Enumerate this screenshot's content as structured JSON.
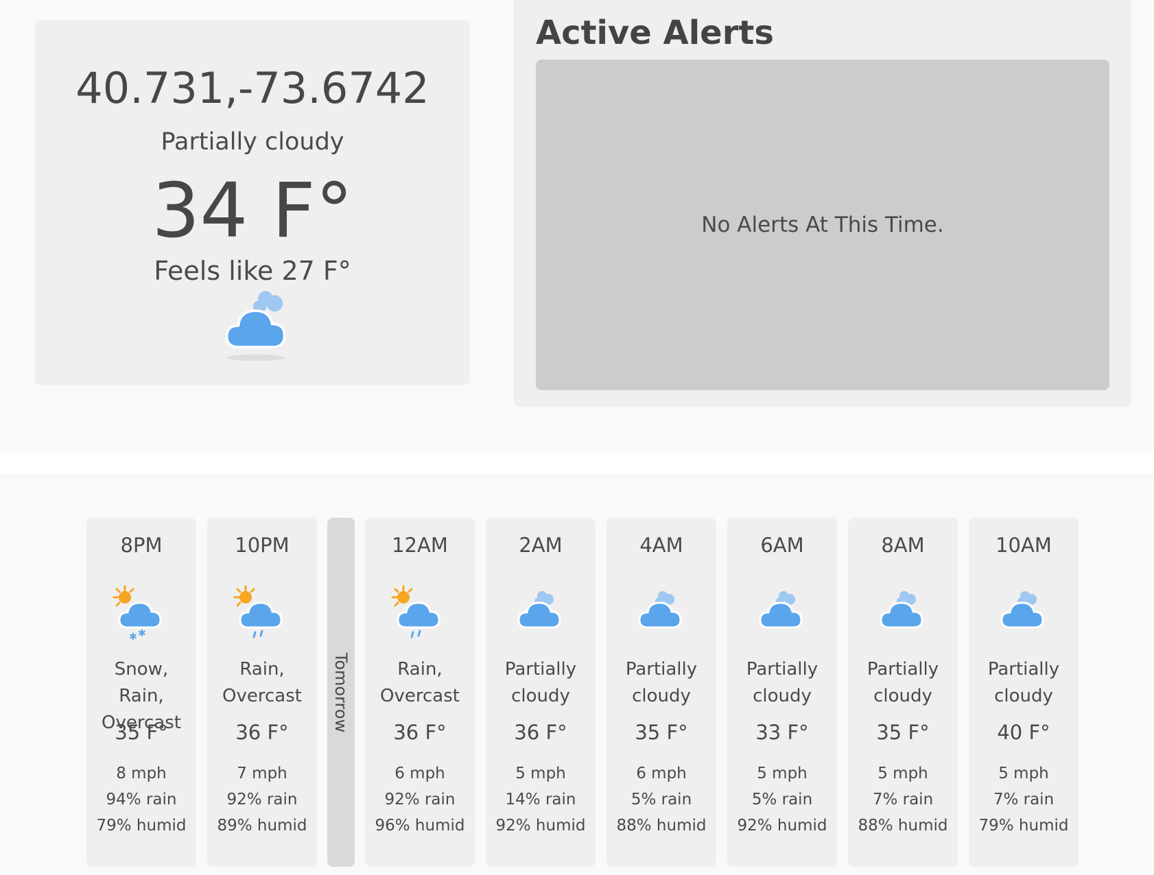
{
  "current": {
    "location": "40.731,-73.6742",
    "condition": "Partially cloudy",
    "temperature": "34 F°",
    "feels_like": "Feels like 27 F°",
    "icon": "partly-cloudy-icon"
  },
  "alerts": {
    "title": "Active Alerts",
    "message": "No Alerts At This Time."
  },
  "colors": {
    "cloud": "#5aa5ec",
    "cloud_light": "#9ec8f2",
    "sun": "#f5a623",
    "panel": "#efefef",
    "alert_box": "#cccccc"
  },
  "divider_label": "Tomorrow",
  "hourly": [
    {
      "time": "8PM",
      "icon": "snow-rain-icon",
      "condition": "Snow, Rain,\nOvercast",
      "temp": "35 F°",
      "wind": "8 mph",
      "rain": "94% rain",
      "humid": "79% humid"
    },
    {
      "time": "10PM",
      "icon": "rain-sun-icon",
      "condition": "Rain,\nOvercast",
      "temp": "36 F°",
      "wind": "7 mph",
      "rain": "92% rain",
      "humid": "89% humid"
    },
    {
      "time": "12AM",
      "icon": "rain-sun-icon",
      "condition": "Rain,\nOvercast",
      "temp": "36 F°",
      "wind": "6 mph",
      "rain": "92% rain",
      "humid": "96% humid"
    },
    {
      "time": "2AM",
      "icon": "partly-cloudy-icon",
      "condition": "Partially\ncloudy",
      "temp": "36 F°",
      "wind": "5 mph",
      "rain": "14% rain",
      "humid": "92% humid"
    },
    {
      "time": "4AM",
      "icon": "partly-cloudy-icon",
      "condition": "Partially\ncloudy",
      "temp": "35 F°",
      "wind": "6 mph",
      "rain": "5% rain",
      "humid": "88% humid"
    },
    {
      "time": "6AM",
      "icon": "partly-cloudy-icon",
      "condition": "Partially\ncloudy",
      "temp": "33 F°",
      "wind": "5 mph",
      "rain": "5% rain",
      "humid": "92% humid"
    },
    {
      "time": "8AM",
      "icon": "partly-cloudy-icon",
      "condition": "Partially\ncloudy",
      "temp": "35 F°",
      "wind": "5 mph",
      "rain": "7% rain",
      "humid": "88% humid"
    },
    {
      "time": "10AM",
      "icon": "partly-cloudy-icon",
      "condition": "Partially\ncloudy",
      "temp": "40 F°",
      "wind": "5 mph",
      "rain": "7% rain",
      "humid": "79% humid"
    }
  ]
}
